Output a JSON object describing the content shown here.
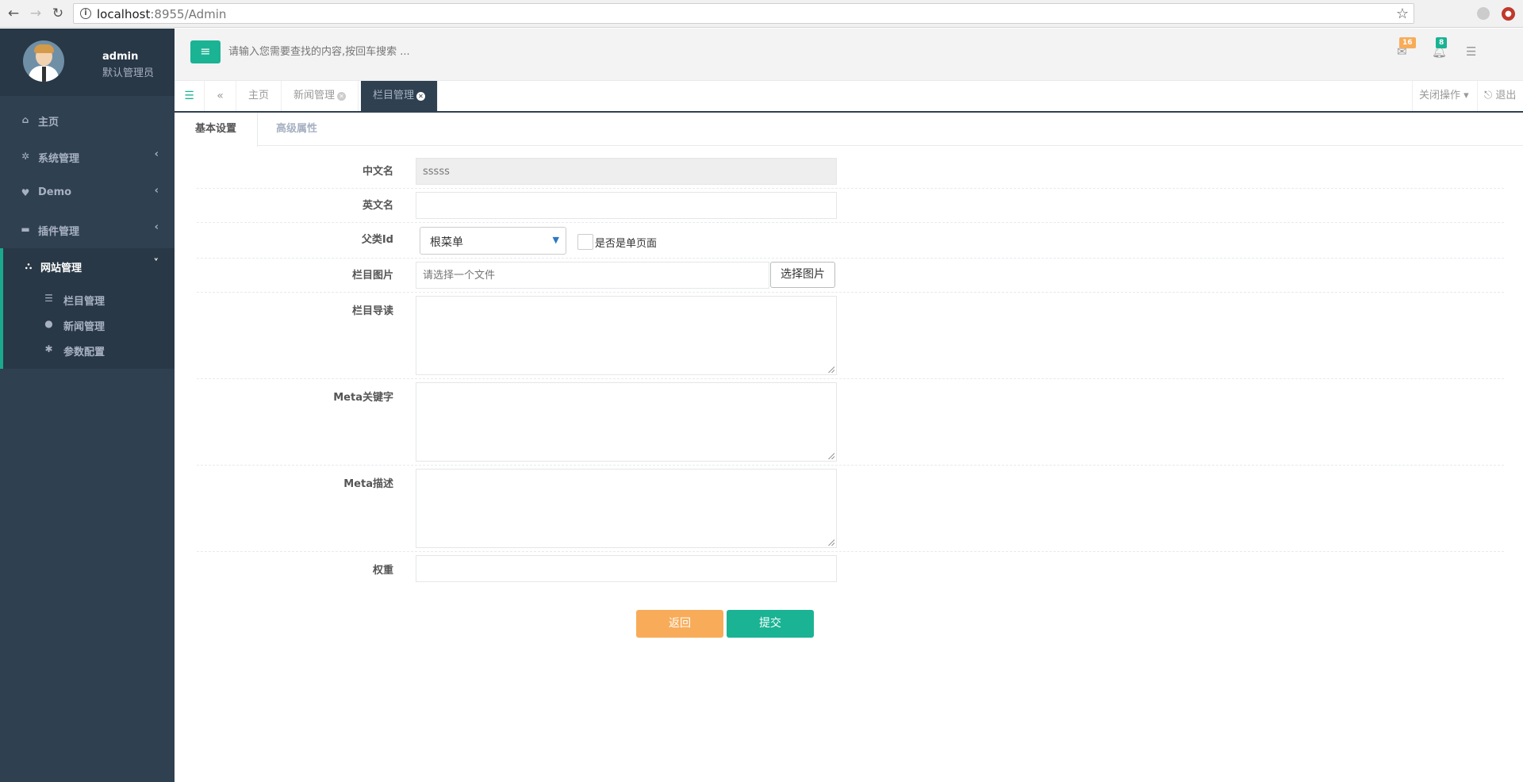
{
  "browser": {
    "url_host": "localhost",
    "url_rest": ":8955/Admin"
  },
  "sidebar": {
    "user_name": "admin",
    "user_role": "默认管理员",
    "items": [
      {
        "label": "主页",
        "icon": "home-icon"
      },
      {
        "label": "系统管理",
        "icon": "gear-icon"
      },
      {
        "label": "Demo",
        "icon": "heart-icon"
      },
      {
        "label": "插件管理",
        "icon": "plug-icon"
      },
      {
        "label": "网站管理",
        "icon": "sitemap-icon"
      }
    ],
    "subitems": [
      {
        "label": "栏目管理",
        "icon": "list-icon"
      },
      {
        "label": "新闻管理",
        "icon": "globe-icon"
      },
      {
        "label": "参数配置",
        "icon": "asterisk-icon"
      }
    ]
  },
  "header": {
    "search_placeholder": "请输入您需要查找的内容,按回车搜索 ...",
    "mail_count": "16",
    "notify_count": "8",
    "colors": {
      "mail_badge": "#f8ac59",
      "notify_badge": "#1ab394"
    }
  },
  "tabs": {
    "items": [
      "主页",
      "新闻管理",
      "栏目管理"
    ],
    "close_ops": "关闭操作",
    "logout": "退出"
  },
  "form_tabs": [
    "基本设置",
    "高级属性"
  ],
  "form": {
    "labels": {
      "cn_name": "中文名",
      "en_name": "英文名",
      "parent_id": "父类Id",
      "image": "栏目图片",
      "intro": "栏目导读",
      "meta_keywords": "Meta关键字",
      "meta_desc": "Meta描述",
      "weight": "权重"
    },
    "cn_name_value": "sssss",
    "en_name_value": "",
    "parent_select_value": "根菜单",
    "single_page_label": "是否是单页面",
    "image_placeholder": "请选择一个文件",
    "choose_image_button": "选择图片",
    "weight_value": "",
    "back_button": "返回",
    "submit_button": "提交"
  }
}
